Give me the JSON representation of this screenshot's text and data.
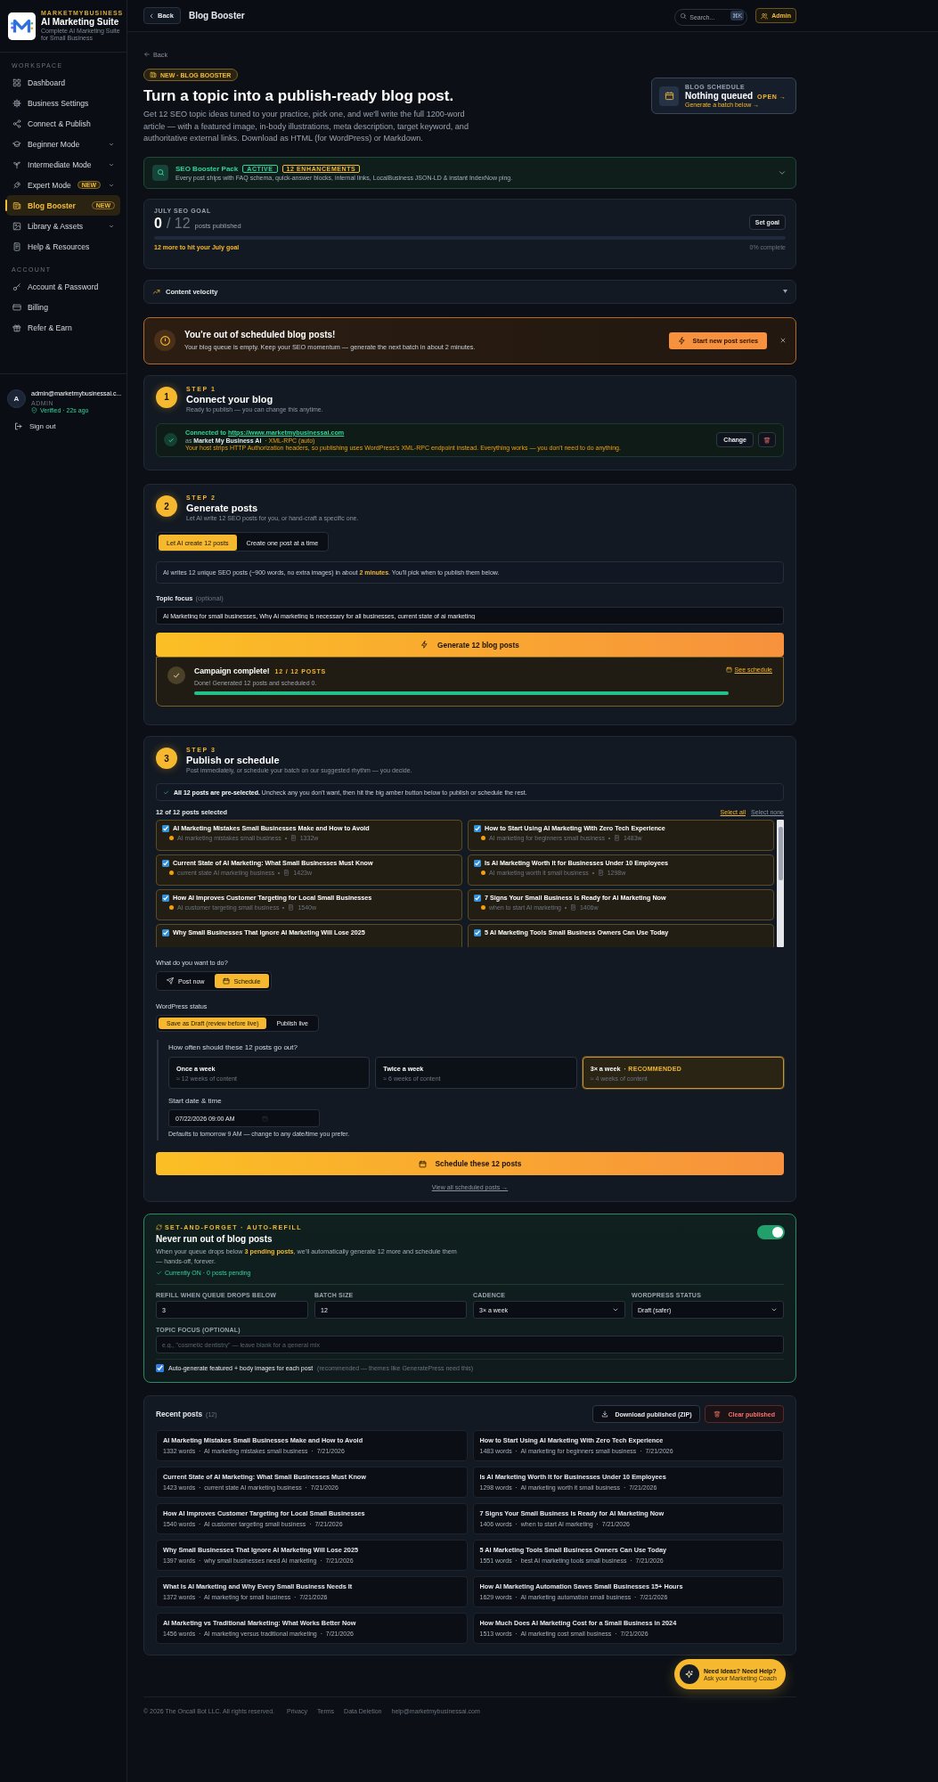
{
  "sidebar": {
    "brand_top": "MARKETMYBUSINESS",
    "brand_title": "AI Marketing Suite",
    "brand_subtitle": "Complete AI Marketing Suite for Small Business",
    "sections": [
      {
        "heading": "WORKSPACE",
        "items": [
          {
            "label": "Dashboard",
            "selected": false,
            "expandable": false
          },
          {
            "label": "Business Settings",
            "selected": false,
            "expandable": false
          },
          {
            "label": "Connect & Publish",
            "selected": false,
            "expandable": false
          },
          {
            "label": "Beginner Mode",
            "selected": false,
            "expandable": true
          },
          {
            "label": "Intermediate Mode",
            "selected": false,
            "expandable": true
          },
          {
            "label": "Expert Mode",
            "badge": "NEW",
            "selected": false,
            "expandable": true
          },
          {
            "label": "Blog Booster",
            "badge": "NEW",
            "selected": true,
            "expandable": false
          },
          {
            "label": "Library & Assets",
            "selected": false,
            "expandable": true
          },
          {
            "label": "Help & Resources",
            "selected": false,
            "expandable": false
          }
        ]
      },
      {
        "heading": "ACCOUNT",
        "items": [
          {
            "label": "Account & Password",
            "selected": false,
            "expandable": false
          },
          {
            "label": "Billing",
            "selected": false,
            "expandable": false
          },
          {
            "label": "Refer & Earn",
            "selected": false,
            "expandable": false
          }
        ]
      }
    ],
    "user": {
      "avatar": "A",
      "email": "admin@marketmybusinessai.c...",
      "role": "ADMIN",
      "status": "Verified · 22s ago"
    },
    "sign_out": "Sign out"
  },
  "topbar": {
    "back": "Back",
    "title": "Blog Booster",
    "search": {
      "placeholder": "Search..."
    },
    "shortcut": "⌘K",
    "account": "Admin"
  },
  "hero": {
    "back_link": "Back",
    "badge": "NEW · BLOG BOOSTER",
    "title": "Turn a topic into a publish-ready blog post.",
    "description": "Get 12 SEO topic ideas tuned to your practice, pick one, and we'll write the full 1200-word article — with a featured image, in-body illustrations, meta description, target keyword, and authoritative external links. Download as HTML (for WordPress) or Markdown.",
    "schedule_card": {
      "label": "BLOG SCHEDULE",
      "status": "Nothing queued",
      "action": "OPEN →",
      "hint": "Generate a batch below →"
    }
  },
  "seo_pack": {
    "title": "SEO Booster Pack",
    "tags": [
      {
        "label": "ACTIVE",
        "color": "#34d399"
      },
      {
        "label": "12 ENHANCEMENTS",
        "color": "#f5b82e"
      }
    ],
    "description": "Every post ships with FAQ schema, quick-answer blocks, internal links, LocalBusiness JSON-LD & instant IndexNow ping.",
    "expanded": false
  },
  "goal": {
    "label": "JULY SEO GOAL",
    "current": "0",
    "total": "/ 12",
    "unit": "posts published",
    "button": "Set goal",
    "level": 0,
    "hint": "12 more to hit your July goal",
    "percent": "0% complete"
  },
  "velocity": {
    "title": "Content velocity",
    "expanded": false
  },
  "alert": {
    "title": "You're out of scheduled blog posts!",
    "text": "Your blog queue is empty. Keep your SEO momentum — generate the next batch in about 2 minutes.",
    "button": "Start new post series"
  },
  "step1": {
    "number": "1",
    "label": "STEP 1",
    "title": "Connect your blog",
    "subtitle": "Ready to publish — you can change this anytime.",
    "connection": {
      "prefix": "Connected to",
      "url": "https://www.marketmybusinessai.com",
      "account_line": "as **Market My Business Ai**",
      "method": "· XML-RPC (auto)",
      "note": "Your host strips HTTP Authorization headers, so publishing uses WordPress's XML-RPC endpoint instead. Everything works — you don't need to do anything.",
      "button": "Change"
    }
  },
  "step2": {
    "number": "2",
    "label": "STEP 2",
    "title": "Generate posts",
    "subtitle": "Let AI write 12 SEO posts for you, or hand-craft a specific one.",
    "modes": [
      {
        "label": "Let AI create 12 posts",
        "selected": true
      },
      {
        "label": "Create one post at a time",
        "selected": false
      }
    ],
    "info": "AI writes 12 unique SEO posts (~900 words, no extra images) in about **2 minutes**. You'll pick when to publish them below.",
    "topic_label": "Topic focus",
    "topic_optional": "(optional)",
    "topic_value": "Ai Marketing for small businesses, Why Ai marketing is necessary for all businesses, current state of ai marketing",
    "generate_button": "Generate 12 blog posts",
    "campaign": {
      "title": "Campaign complete!",
      "count": "12 / 12 POSTS",
      "text": "Done! Generated 12 posts and scheduled 0.",
      "link": "See schedule",
      "level": 1
    }
  },
  "step3": {
    "number": "3",
    "label": "STEP 3",
    "title": "Publish or schedule",
    "subtitle": "Post immediately, or schedule your batch on our suggested rhythm — you decide.",
    "notice": "**All 12 posts are pre-selected.** Uncheck any you don't want, then hit the big amber button below to publish or schedule the rest.",
    "selected_count": "12 of 12 posts selected",
    "links": [
      "Select all",
      "Select none"
    ],
    "posts": [
      {
        "title": "AI Marketing Mistakes Small Businesses Make and How to Avoid",
        "keyword": "AI marketing mistakes small business",
        "words": "1332w",
        "checked": true
      },
      {
        "title": "How to Start Using AI Marketing With Zero Tech Experience",
        "keyword": "AI marketing for beginners small business",
        "words": "1483w",
        "checked": true
      },
      {
        "title": "Current State of AI Marketing: What Small Businesses Must Know",
        "keyword": "current state AI marketing business",
        "words": "1423w",
        "checked": true
      },
      {
        "title": "Is AI Marketing Worth It for Businesses Under 10 Employees",
        "keyword": "AI marketing worth it small business",
        "words": "1298w",
        "checked": true
      },
      {
        "title": "How AI Improves Customer Targeting for Local Small Businesses",
        "keyword": "AI customer targeting small business",
        "words": "1540w",
        "checked": true
      },
      {
        "title": "7 Signs Your Small Business Is Ready for AI Marketing Now",
        "keyword": "when to start AI marketing",
        "words": "1406w",
        "checked": true
      },
      {
        "title": "Why Small Businesses That Ignore AI Marketing Will Lose 2025",
        "checked": true
      },
      {
        "title": "5 AI Marketing Tools Small Business Owners Can Use Today",
        "checked": true
      }
    ],
    "action_label": "What do you want to do?",
    "actions": [
      {
        "label": "Post now",
        "selected": false
      },
      {
        "label": "Schedule",
        "selected": true
      }
    ],
    "status_label": "WordPress status",
    "statuses": [
      {
        "label": "Save as Draft (review before live)",
        "selected": true
      },
      {
        "label": "Publish live",
        "selected": false
      }
    ],
    "frequency_label": "How often should these 12 posts go out?",
    "frequencies": [
      {
        "title": "Once a week",
        "note": "≈ 12 weeks of content",
        "selected": false
      },
      {
        "title": "Twice a week",
        "note": "≈ 6 weeks of content",
        "selected": false
      },
      {
        "title": "3× a week",
        "tag": "· RECOMMENDED",
        "note": "≈ 4 weeks of content",
        "selected": true
      }
    ],
    "start_label": "Start date & time",
    "start_value": "07/22/2026 09:00 AM",
    "start_hint": "Defaults to tomorrow 9 AM — change to any date/time you prefer.",
    "button": "Schedule these 12 posts",
    "view_link": "View all scheduled posts →"
  },
  "auto_refill": {
    "eyebrow": "SET-AND-FORGET · AUTO-REFILL",
    "title": "Never run out of blog posts",
    "description": "When your queue drops below **3 pending posts**, we'll automatically generate 12 more and schedule them — hands-off, forever.",
    "status": "Currently ON · 0 posts pending",
    "on": true,
    "fields": [
      {
        "label": "REFILL WHEN QUEUE DROPS BELOW",
        "value": "3",
        "kind": "input"
      },
      {
        "label": "BATCH SIZE",
        "value": "12",
        "kind": "input"
      },
      {
        "label": "CADENCE",
        "value": "3× a week",
        "kind": "select"
      },
      {
        "label": "WORDPRESS STATUS",
        "value": "Draft (safer)",
        "kind": "select"
      }
    ],
    "topic": {
      "label": "TOPIC FOCUS (OPTIONAL)",
      "placeholder": "e.g., \"cosmetic dentistry\" — leave blank for a general mix"
    },
    "images": {
      "checked": true,
      "label": "Auto-generate featured + body images for each post",
      "note": "(recommended — themes like GeneratePress need this)"
    }
  },
  "recent": {
    "title": "Recent posts",
    "count": "(12)",
    "download": "Download published (ZIP)",
    "clear": "Clear published",
    "posts": [
      {
        "title": "AI Marketing Mistakes Small Businesses Make and How to Avoid",
        "meta": "1332 words  ·  AI marketing mistakes small business  ·  7/21/2026"
      },
      {
        "title": "How to Start Using AI Marketing With Zero Tech Experience",
        "meta": "1483 words  ·  AI marketing for beginners small business  ·  7/21/2026"
      },
      {
        "title": "Current State of AI Marketing: What Small Businesses Must Know",
        "meta": "1423 words  ·  current state AI marketing business  ·  7/21/2026"
      },
      {
        "title": "Is AI Marketing Worth It for Businesses Under 10 Employees",
        "meta": "1298 words  ·  AI marketing worth it small business  ·  7/21/2026"
      },
      {
        "title": "How AI Improves Customer Targeting for Local Small Businesses",
        "meta": "1540 words  ·  AI customer targeting small business  ·  7/21/2026"
      },
      {
        "title": "7 Signs Your Small Business Is Ready for AI Marketing Now",
        "meta": "1406 words  ·  when to start AI marketing  ·  7/21/2026"
      },
      {
        "title": "Why Small Businesses That Ignore AI Marketing Will Lose 2025",
        "meta": "1397 words  ·  why small businesses need AI marketing  ·  7/21/2026"
      },
      {
        "title": "5 AI Marketing Tools Small Business Owners Can Use Today",
        "meta": "1551 words  ·  best AI marketing tools small business  ·  7/21/2026"
      },
      {
        "title": "What Is AI Marketing and Why Every Small Business Needs It",
        "meta": "1372 words  ·  AI marketing for small business  ·  7/21/2026"
      },
      {
        "title": "How AI Marketing Automation Saves Small Businesses 15+ Hours",
        "meta": "1629 words  ·  AI marketing automation small business  ·  7/21/2026"
      },
      {
        "title": "AI Marketing vs Traditional Marketing: What Works Better Now",
        "meta": "1456 words  ·  AI marketing versus traditional marketing  ·  7/21/2026"
      },
      {
        "title": "How Much Does AI Marketing Cost for a Small Business in 2024",
        "meta": "1513 words  ·  AI marketing cost small business  ·  7/21/2026"
      }
    ]
  },
  "coach": {
    "title": "Need Ideas? Need Help?",
    "subtitle": "Ask your Marketing Coach"
  },
  "footer": {
    "copyright": "© 2026 The Oncall Bot LLC. All rights reserved.",
    "links": [
      "Privacy",
      "Terms",
      "Data Deletion",
      "help@marketmybusinessai.com"
    ]
  }
}
